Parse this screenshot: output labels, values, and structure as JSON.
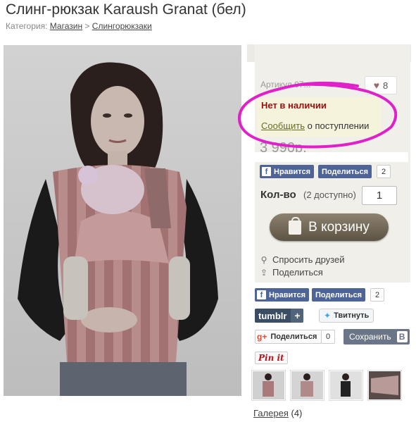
{
  "page": {
    "title": "Слинг-рюкзак Karaush Granat (бел)",
    "breadcrumb": {
      "label": "Категория:",
      "items": [
        "Магазин",
        "Слингорюкзаки"
      ],
      "separator": ">"
    }
  },
  "product": {
    "article": "Артикул 07...",
    "likes": "8",
    "stock_status": "Нет в наличии",
    "notify_link": "Сообщить",
    "notify_text": "о поступлении",
    "price": "3 990р.",
    "quantity_label": "Кол-во",
    "quantity_available": "(2 доступно)",
    "quantity_value": "1",
    "cart_button": "В корзину",
    "ask_friends": "Спросить друзей",
    "share": "Поделиться"
  },
  "social_top": {
    "like_label": "Нравится",
    "share_label": "Поделиться",
    "count": "2"
  },
  "social_bottom": {
    "fb_like_label": "Нравится",
    "fb_share_label": "Поделиться",
    "fb_count": "2",
    "tumblr_label": "tumblr",
    "tumblr_plus": "+",
    "tweet_label": "Твитнуть",
    "gplus_label": "Поделиться",
    "gplus_count": "0",
    "save_label": "Сохранить",
    "save_badge": "B",
    "pinit_label": "Pin it"
  },
  "gallery": {
    "link": "Галерея",
    "count": "(4)"
  },
  "colors": {
    "panel_bg": "#f0efe9",
    "stock_red": "#9a1010",
    "facebook_blue": "#4e6496",
    "annotation_magenta": "#e020c8",
    "cart_brown": "#6f6553"
  }
}
